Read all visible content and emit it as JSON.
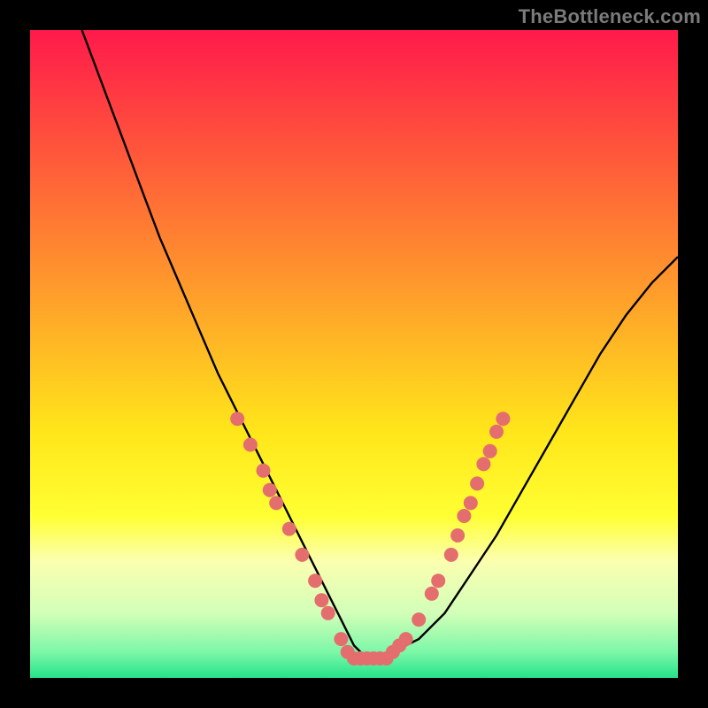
{
  "attribution": "TheBottleneck.com",
  "colors": {
    "frame": "#000000",
    "curve": "#000000",
    "marker": "#e46e6e",
    "gradient_stops": [
      {
        "pct": 0,
        "color": "#ff1a4b"
      },
      {
        "pct": 20,
        "color": "#ff5a3a"
      },
      {
        "pct": 42,
        "color": "#ffa22a"
      },
      {
        "pct": 62,
        "color": "#ffe61a"
      },
      {
        "pct": 75,
        "color": "#ffff33"
      },
      {
        "pct": 82,
        "color": "#fbffb0"
      },
      {
        "pct": 90,
        "color": "#d2ffb8"
      },
      {
        "pct": 96,
        "color": "#7cf7a8"
      },
      {
        "pct": 100,
        "color": "#25e38a"
      }
    ]
  },
  "chart_data": {
    "type": "line",
    "title": "",
    "xlabel": "",
    "ylabel": "",
    "xlim": [
      0,
      100
    ],
    "ylim": [
      0,
      100
    ],
    "grid": false,
    "series": [
      {
        "name": "bottleneck-curve",
        "x": [
          8,
          11,
          14,
          17,
          20,
          23,
          26,
          29,
          32,
          35,
          38,
          40,
          42,
          44,
          46,
          48,
          50,
          52,
          54,
          56,
          60,
          64,
          68,
          72,
          76,
          80,
          84,
          88,
          92,
          96,
          100
        ],
        "y": [
          100,
          92,
          84,
          76,
          68,
          61,
          54,
          47,
          41,
          35,
          29,
          25,
          21,
          17,
          13,
          9,
          5,
          3,
          3,
          4,
          6,
          10,
          16,
          22,
          29,
          36,
          43,
          50,
          56,
          61,
          65
        ]
      }
    ],
    "markers": [
      {
        "x": 32,
        "y": 40
      },
      {
        "x": 34,
        "y": 36
      },
      {
        "x": 36,
        "y": 32
      },
      {
        "x": 37,
        "y": 29
      },
      {
        "x": 38,
        "y": 27
      },
      {
        "x": 40,
        "y": 23
      },
      {
        "x": 42,
        "y": 19
      },
      {
        "x": 44,
        "y": 15
      },
      {
        "x": 45,
        "y": 12
      },
      {
        "x": 46,
        "y": 10
      },
      {
        "x": 48,
        "y": 6
      },
      {
        "x": 49,
        "y": 4
      },
      {
        "x": 50,
        "y": 3
      },
      {
        "x": 51,
        "y": 3
      },
      {
        "x": 52,
        "y": 3
      },
      {
        "x": 53,
        "y": 3
      },
      {
        "x": 54,
        "y": 3
      },
      {
        "x": 55,
        "y": 3
      },
      {
        "x": 56,
        "y": 4
      },
      {
        "x": 57,
        "y": 5
      },
      {
        "x": 58,
        "y": 6
      },
      {
        "x": 60,
        "y": 9
      },
      {
        "x": 62,
        "y": 13
      },
      {
        "x": 63,
        "y": 15
      },
      {
        "x": 65,
        "y": 19
      },
      {
        "x": 66,
        "y": 22
      },
      {
        "x": 67,
        "y": 25
      },
      {
        "x": 68,
        "y": 27
      },
      {
        "x": 69,
        "y": 30
      },
      {
        "x": 70,
        "y": 33
      },
      {
        "x": 71,
        "y": 35
      },
      {
        "x": 72,
        "y": 38
      },
      {
        "x": 73,
        "y": 40
      }
    ]
  }
}
